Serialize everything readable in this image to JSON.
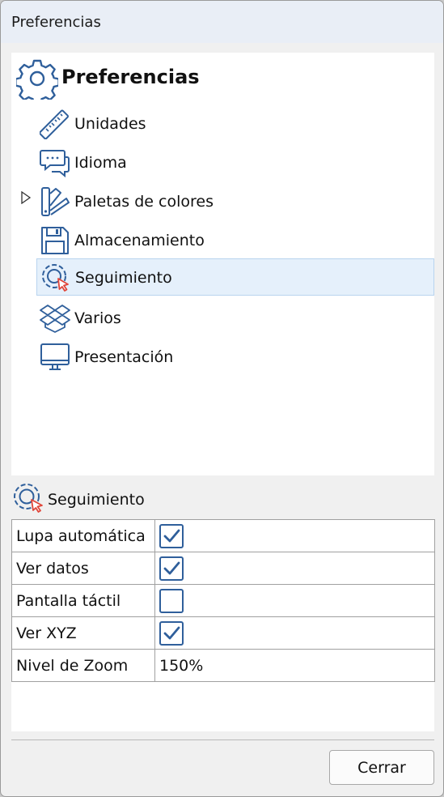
{
  "window": {
    "title": "Preferencias"
  },
  "tree": {
    "root_label": "Preferencias",
    "items": [
      {
        "label": "Unidades",
        "icon": "ruler-icon"
      },
      {
        "label": "Idioma",
        "icon": "speech-bubbles-icon"
      },
      {
        "label": "Paletas de colores",
        "icon": "color-swatch-icon",
        "expandable": true
      },
      {
        "label": "Almacenamiento",
        "icon": "floppy-disk-icon"
      },
      {
        "label": "Seguimiento",
        "icon": "tracking-cursor-icon",
        "selected": true
      },
      {
        "label": "Varios",
        "icon": "dropbox-box-icon"
      },
      {
        "label": "Presentación",
        "icon": "monitor-icon"
      }
    ]
  },
  "section": {
    "label": "Seguimiento",
    "icon": "tracking-cursor-icon"
  },
  "properties": [
    {
      "name": "Lupa automática",
      "type": "checkbox",
      "checked": true
    },
    {
      "name": "Ver datos",
      "type": "checkbox",
      "checked": true
    },
    {
      "name": "Pantalla táctil",
      "type": "checkbox",
      "checked": false
    },
    {
      "name": "Ver XYZ",
      "type": "checkbox",
      "checked": true
    },
    {
      "name": "Nivel de Zoom",
      "type": "text",
      "value": "150%"
    }
  ],
  "buttons": {
    "close_label": "Cerrar"
  },
  "colors": {
    "icon_blue": "#2f5f9b",
    "cursor_red": "#e0463a",
    "selection_bg": "#e5f0fb"
  }
}
